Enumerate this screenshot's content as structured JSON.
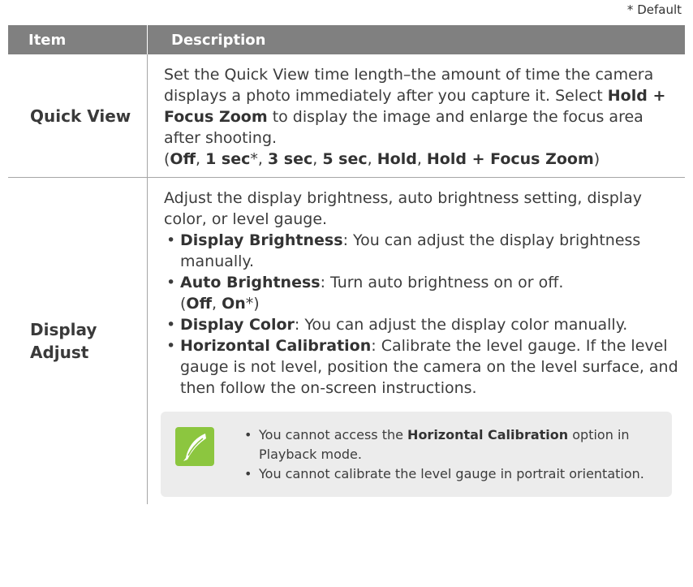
{
  "default_note": "* Default",
  "table": {
    "headers": {
      "item": "Item",
      "description": "Description"
    },
    "quick_view": {
      "item": "Quick View",
      "text_1": "Set the Quick View time length–the amount of time the camera displays a photo immediately after you capture it. Select ",
      "bold_1": "Hold + Focus Zoom",
      "text_2": " to display the image and enlarge the focus area after shooting.",
      "options": {
        "open": "(",
        "o1": "Off",
        "sep1": ", ",
        "o2": "1 sec",
        "star": "*",
        "sep2": ", ",
        "o3": "3 sec",
        "sep3": ", ",
        "o4": "5 sec",
        "sep4": ", ",
        "o5": "Hold",
        "sep5": ", ",
        "o6": "Hold + Focus Zoom",
        "close": ")"
      }
    },
    "display_adjust": {
      "item_line1": "Display",
      "item_line2": "Adjust",
      "intro": "Adjust the display brightness, auto brightness setting, display color, or level gauge.",
      "bullets": [
        {
          "bold": "Display Brightness",
          "text": ": You can adjust the display brightness manually."
        },
        {
          "bold": "Auto Brightness",
          "text": ": Turn auto brightness on or off."
        },
        {
          "bold": "Display Color",
          "text": ": You can adjust the display color manually."
        },
        {
          "bold": "Horizontal Calibration",
          "text": ": Calibrate the level gauge. If the level gauge is not level, position the camera on the level surface, and then follow the on-screen instructions."
        }
      ],
      "auto_options": {
        "open": "(",
        "o1": "Off",
        "sep": ", ",
        "o2": "On",
        "star": "*",
        "close": ")"
      },
      "note": {
        "icon": "pen-nib-icon",
        "line1_pre": "You cannot access the ",
        "line1_bold": "Horizontal Calibration",
        "line1_post": " option in Playback mode.",
        "line2": "You cannot calibrate the level gauge in portrait orientation."
      }
    }
  },
  "colors": {
    "header_bg": "#808080",
    "note_bg": "#ececec",
    "icon_bg": "#8cc63f"
  }
}
